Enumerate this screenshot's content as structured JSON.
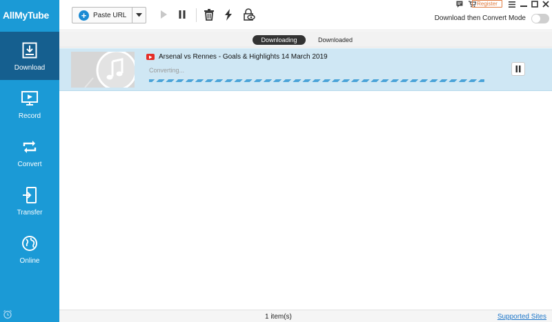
{
  "app": {
    "name": "AllMyTube"
  },
  "sidebar": {
    "items": [
      {
        "label": "Download",
        "icon": "download-icon",
        "active": true
      },
      {
        "label": "Record",
        "icon": "record-icon"
      },
      {
        "label": "Convert",
        "icon": "convert-icon"
      },
      {
        "label": "Transfer",
        "icon": "transfer-icon"
      },
      {
        "label": "Online",
        "icon": "globe-icon"
      }
    ],
    "bottom_icon": "alarm-icon"
  },
  "toolbar": {
    "paste_label": "Paste URL",
    "icons": [
      "play-icon",
      "pause-icon",
      "trash-icon",
      "lightning-icon",
      "private-mode-icon"
    ]
  },
  "window": {
    "register_label": "Register",
    "controls": [
      "feedback-icon",
      "cart-icon",
      "menu-icon",
      "minimize-icon",
      "maximize-icon",
      "close-icon"
    ]
  },
  "mode": {
    "label": "Download then Convert Mode",
    "enabled": false
  },
  "tabs": [
    {
      "label": "Downloading",
      "active": true
    },
    {
      "label": "Downloaded",
      "active": false
    }
  ],
  "download": {
    "title": "Arsenal vs Rennes - Goals & Highlights 14 March 2019",
    "status": "Converting...",
    "source_icon": "youtube-icon",
    "thumbnail_icon": "music-note-icon"
  },
  "footer": {
    "count": "1 item(s)",
    "supported_link": "Supported Sites"
  },
  "colors": {
    "sidebar": "#1b9ad6",
    "sidebar_active": "#155f8f",
    "item_bg": "#cfe7f4",
    "register": "#e07a3e",
    "link": "#1a74c8"
  }
}
